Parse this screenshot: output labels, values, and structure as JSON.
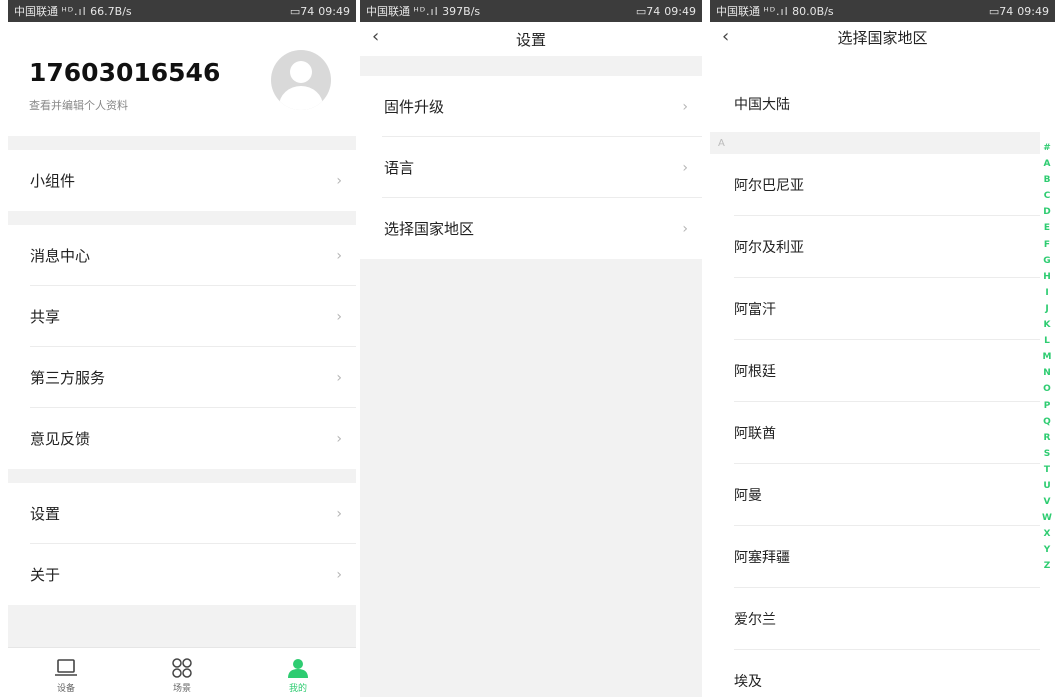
{
  "screen1": {
    "statusbar": {
      "carrier": "中国联通",
      "signal": "ᴴᴰ.ıl",
      "speed": "66.7B/s",
      "battery": "74",
      "time": "09:49"
    },
    "profile": {
      "phone": "17603016546",
      "edit_label": "查看并编辑个人资料"
    },
    "menu": {
      "widgets": "小组件",
      "messages": "消息中心",
      "share": "共享",
      "third_party": "第三方服务",
      "feedback": "意见反馈",
      "settings": "设置",
      "about": "关于"
    },
    "tabs": {
      "devices": "设备",
      "scenes": "场景",
      "mine": "我的"
    },
    "accent": "#2ecc71"
  },
  "screen2": {
    "statusbar": {
      "carrier": "中国联通",
      "signal": "ᴴᴰ.ıl",
      "speed": "397B/s",
      "battery": "74",
      "time": "09:49"
    },
    "title": "设置",
    "items": {
      "firmware": "固件升级",
      "language": "语言",
      "region": "选择国家地区"
    }
  },
  "screen3": {
    "statusbar": {
      "carrier": "中国联通",
      "signal": "ᴴᴰ.ıl",
      "speed": "80.0B/s",
      "battery": "74",
      "time": "09:49"
    },
    "title": "选择国家地区",
    "mainland": "中国大陆",
    "section_a": "A",
    "countries": [
      "阿尔巴尼亚",
      "阿尔及利亚",
      "阿富汗",
      "阿根廷",
      "阿联酋",
      "阿曼",
      "阿塞拜疆",
      "爱尔兰",
      "埃及"
    ],
    "index": [
      "#",
      "A",
      "B",
      "C",
      "D",
      "E",
      "F",
      "G",
      "H",
      "I",
      "J",
      "K",
      "L",
      "M",
      "N",
      "O",
      "P",
      "Q",
      "R",
      "S",
      "T",
      "U",
      "V",
      "W",
      "X",
      "Y",
      "Z"
    ]
  },
  "icons": {
    "chevron": "chevron-right-icon",
    "back": "back-arrow-icon",
    "devices": "laptop-icon",
    "scenes": "grid-icon",
    "mine": "person-icon",
    "avatar": "avatar-placeholder-icon"
  }
}
